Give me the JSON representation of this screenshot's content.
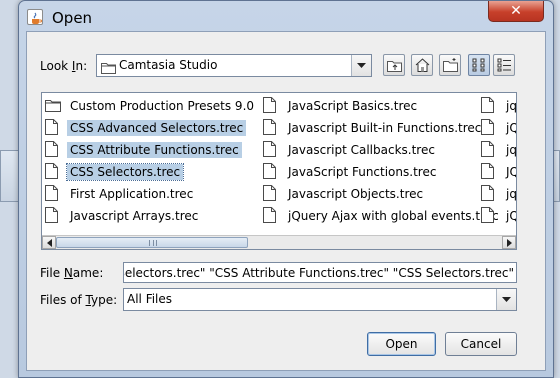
{
  "dialog": {
    "title": "Open",
    "close_glyph": "✕"
  },
  "look_in": {
    "label": "Look In:",
    "label_pre": "Look ",
    "label_mnemonic": "I",
    "label_post": "n:",
    "value": "Camtasia Studio",
    "folder_icon": "folder-icon"
  },
  "toolbar": {
    "buttons": [
      {
        "name": "up-one-level-button",
        "icon": "up-folder-icon"
      },
      {
        "name": "home-button",
        "icon": "home-icon"
      },
      {
        "name": "new-folder-button",
        "icon": "new-folder-icon"
      },
      {
        "name": "list-view-button",
        "icon": "list-view-icon",
        "active": true
      },
      {
        "name": "details-view-button",
        "icon": "details-view-icon",
        "active": false
      }
    ]
  },
  "files": {
    "columns": [
      [
        {
          "name": "Custom Production Presets 9.0",
          "type": "folder",
          "selected": false
        },
        {
          "name": "CSS Advanced Selectors.trec",
          "type": "file",
          "selected": true
        },
        {
          "name": "CSS Attribute Functions.trec",
          "type": "file",
          "selected": true
        },
        {
          "name": "CSS Selectors.trec",
          "type": "file",
          "selected": true,
          "focused": true
        },
        {
          "name": "First Application.trec",
          "type": "file",
          "selected": false
        },
        {
          "name": "Javascript Arrays.trec",
          "type": "file",
          "selected": false
        }
      ],
      [
        {
          "name": "JavaScript Basics.trec",
          "type": "file",
          "selected": false
        },
        {
          "name": "Javascript Built-in Functions.trec",
          "type": "file",
          "selected": false
        },
        {
          "name": "Javascript Callbacks.trec",
          "type": "file",
          "selected": false
        },
        {
          "name": "JavaScript Functions.trec",
          "type": "file",
          "selected": false
        },
        {
          "name": "Javascript Objects.trec",
          "type": "file",
          "selected": false
        },
        {
          "name": "jQuery Ajax with global events.trec",
          "type": "file",
          "selected": false
        }
      ],
      [
        {
          "name": "jqu",
          "type": "file",
          "selected": false
        },
        {
          "name": "jQu",
          "type": "file",
          "selected": false
        },
        {
          "name": "jqu",
          "type": "file",
          "selected": false
        },
        {
          "name": "JQ",
          "type": "file",
          "selected": false
        },
        {
          "name": "jqu",
          "type": "file",
          "selected": false
        },
        {
          "name": "jQu",
          "type": "file",
          "selected": false
        }
      ]
    ]
  },
  "file_name": {
    "label": "File Name:",
    "label_pre": "File ",
    "label_mnemonic": "N",
    "label_post": "ame:",
    "value": "inced Selectors.trec\" \"CSS Attribute Functions.trec\" \"CSS Selectors.trec\""
  },
  "files_of_type": {
    "label": "Files of Type:",
    "label_pre": "Files of ",
    "label_mnemonic": "T",
    "label_post": "ype:",
    "value": "All Files"
  },
  "buttons": {
    "open": "Open",
    "cancel": "Cancel"
  },
  "colors": {
    "selection": "#b8cfe5",
    "titlebar": "#c6d5e8",
    "close": "#c7402a"
  }
}
